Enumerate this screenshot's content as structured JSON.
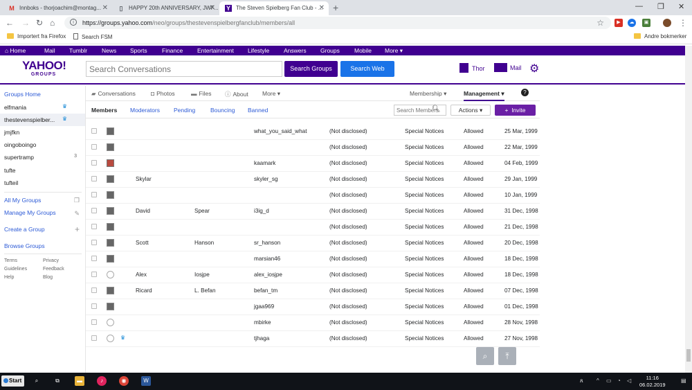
{
  "browser": {
    "tabs": [
      {
        "title": "Innboks - thorjoachim@montag...",
        "icon": "gmail-icon",
        "active": false
      },
      {
        "title": "HAPPY 20th ANNIVERSARY, JWF...",
        "icon": "document-icon",
        "active": false
      },
      {
        "title": "The Steven Spielberg Fan Club - ...",
        "icon": "yahoo-icon",
        "active": true
      }
    ],
    "url_host": "https://groups.yahoo.com",
    "url_path": "/neo/groups/thestevenspielbergfanclub/members/all",
    "bookmarks": [
      "Importert fra Firefox",
      "Search FSM"
    ],
    "other_bookmarks": "Andre bokmerker"
  },
  "ynav": {
    "items": [
      "Home",
      "Mail",
      "Tumblr",
      "News",
      "Sports",
      "Finance",
      "Entertainment",
      "Lifestyle",
      "Answers",
      "Groups",
      "Mobile",
      "More"
    ]
  },
  "header": {
    "logo_text": "YAHOO!",
    "logo_sub": "GROUPS",
    "search_placeholder": "Search Conversations",
    "search_groups_label": "Search Groups",
    "search_web_label": "Search Web",
    "user_name": "Thor",
    "mail_label": "Mail",
    "accent": "#400090"
  },
  "sidebar": {
    "groups_home": "Groups Home",
    "groups": [
      {
        "name": "elfmania",
        "crown": true,
        "count": ""
      },
      {
        "name": "thestevenspielber...",
        "crown": true,
        "count": "",
        "active": true
      },
      {
        "name": "jmjfkn",
        "crown": false,
        "count": ""
      },
      {
        "name": "oingoboingo",
        "crown": false,
        "count": ""
      },
      {
        "name": "supertramp",
        "crown": false,
        "count": "3"
      },
      {
        "name": "tufte",
        "crown": false,
        "count": ""
      },
      {
        "name": "tufteil",
        "crown": false,
        "count": ""
      }
    ],
    "all_my_groups": "All My Groups",
    "manage_my_groups": "Manage My Groups",
    "create_group": "Create a Group",
    "browse_groups": "Browse Groups",
    "footer": [
      "Terms",
      "Privacy",
      "Guidelines",
      "Feedback",
      "Help",
      "Blog"
    ]
  },
  "subnav1": {
    "conversations": "Conversations",
    "photos": "Photos",
    "files": "Files",
    "about": "About",
    "more": "More",
    "membership": "Membership",
    "management": "Management"
  },
  "subnav2": {
    "tabs": [
      "Members",
      "Moderators",
      "Pending",
      "Bouncing",
      "Banned"
    ],
    "search_placeholder": "Search Members",
    "actions_label": "Actions",
    "invite_label": "Invite"
  },
  "members": [
    {
      "first": "",
      "last": "",
      "yahoo_id": "what_you_said_what",
      "email": "(Not disclosed)",
      "delivery": "Special Notices",
      "posting": "Allowed",
      "joined": "25 Mar, 1999",
      "avatar": "dark",
      "crown": false
    },
    {
      "first": "",
      "last": "",
      "yahoo_id": "",
      "email": "(Not disclosed)",
      "delivery": "Special Notices",
      "posting": "Allowed",
      "joined": "22 Mar, 1999",
      "avatar": "dark",
      "crown": false
    },
    {
      "first": "",
      "last": "",
      "yahoo_id": "kaamark",
      "email": "(Not disclosed)",
      "delivery": "Special Notices",
      "posting": "Allowed",
      "joined": "04 Feb, 1999",
      "avatar": "photo",
      "crown": false
    },
    {
      "first": "Skylar",
      "last": "",
      "yahoo_id": "skyler_sg",
      "email": "(Not disclosed)",
      "delivery": "Special Notices",
      "posting": "Allowed",
      "joined": "29 Jan, 1999",
      "avatar": "dark",
      "crown": false
    },
    {
      "first": "",
      "last": "",
      "yahoo_id": "",
      "email": "(Not disclosed)",
      "delivery": "Special Notices",
      "posting": "Allowed",
      "joined": "10 Jan, 1999",
      "avatar": "dark",
      "crown": false
    },
    {
      "first": "David",
      "last": "Spear",
      "yahoo_id": "i3ig_d",
      "email": "(Not disclosed)",
      "delivery": "Special Notices",
      "posting": "Allowed",
      "joined": "31 Dec, 1998",
      "avatar": "dark",
      "crown": false
    },
    {
      "first": "",
      "last": "",
      "yahoo_id": "",
      "email": "(Not disclosed)",
      "delivery": "Special Notices",
      "posting": "Allowed",
      "joined": "21 Dec, 1998",
      "avatar": "dark",
      "crown": false
    },
    {
      "first": "Scott",
      "last": "Hanson",
      "yahoo_id": "sr_hanson",
      "email": "(Not disclosed)",
      "delivery": "Special Notices",
      "posting": "Allowed",
      "joined": "20 Dec, 1998",
      "avatar": "dark",
      "crown": false
    },
    {
      "first": "",
      "last": "",
      "yahoo_id": "marsian46",
      "email": "(Not disclosed)",
      "delivery": "Special Notices",
      "posting": "Allowed",
      "joined": "18 Dec, 1998",
      "avatar": "dark",
      "crown": false
    },
    {
      "first": "Alex",
      "last": "Iosjpe",
      "yahoo_id": "alex_iosjpe",
      "email": "(Not disclosed)",
      "delivery": "Special Notices",
      "posting": "Allowed",
      "joined": "18 Dec, 1998",
      "avatar": "light",
      "crown": false
    },
    {
      "first": "Ricard",
      "last": "L. Befan",
      "yahoo_id": "befan_tm",
      "email": "(Not disclosed)",
      "delivery": "Special Notices",
      "posting": "Allowed",
      "joined": "07 Dec, 1998",
      "avatar": "dark",
      "crown": false
    },
    {
      "first": "",
      "last": "",
      "yahoo_id": "jgaa969",
      "email": "(Not disclosed)",
      "delivery": "Special Notices",
      "posting": "Allowed",
      "joined": "01 Dec, 1998",
      "avatar": "dark",
      "crown": false
    },
    {
      "first": "",
      "last": "",
      "yahoo_id": "mbirke",
      "email": "(Not disclosed)",
      "delivery": "Special Notices",
      "posting": "Allowed",
      "joined": "28 Nov, 1998",
      "avatar": "light",
      "crown": false
    },
    {
      "first": "",
      "last": "",
      "yahoo_id": "tjhaga",
      "email": "(Not disclosed)",
      "delivery": "Special Notices",
      "posting": "Allowed",
      "joined": "27 Nov, 1998",
      "avatar": "light",
      "crown": true
    }
  ],
  "taskbar": {
    "start_label": "Start",
    "time": "11:16",
    "date": "06.02.2019"
  }
}
